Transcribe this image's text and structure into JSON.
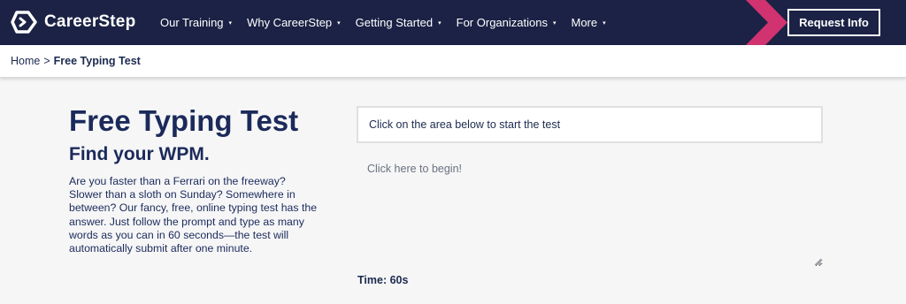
{
  "brand": {
    "name": "CareerStep"
  },
  "nav": {
    "items": [
      {
        "label": "Our Training",
        "caret": "▾"
      },
      {
        "label": "Why CareerStep",
        "caret": "▾"
      },
      {
        "label": "Getting Started",
        "caret": "▾"
      },
      {
        "label": "For Organizations",
        "caret": "▾"
      },
      {
        "label": "More",
        "caret": "▾"
      }
    ],
    "cta_label": "Request Info"
  },
  "breadcrumb": {
    "home": "Home",
    "separator": ">",
    "current": "Free Typing Test"
  },
  "main": {
    "title": "Free Typing Test",
    "subtitle": "Find your WPM.",
    "description": "Are you faster than a Ferrari on the freeway? Slower than a sloth on Sunday? Somewhere in between? Our fancy, free, online typing test has the answer. Just follow the prompt and type as many words as you can in 60 seconds—the test will automatically submit after one minute."
  },
  "test": {
    "prompt": "Click on the area below to start the test",
    "input_value": "",
    "input_placeholder": "Click here to begin!",
    "timer": "Time: 60s"
  },
  "colors": {
    "header_bg": "#1b2245",
    "accent_chevron": "#d0336f",
    "text_primary": "#1b2a5a"
  },
  "icons": {
    "logo": "careerstep-logo-icon",
    "caret": "caret-down-icon",
    "chevron": "chevron-right-icon",
    "grip": "resize-grip-icon"
  }
}
